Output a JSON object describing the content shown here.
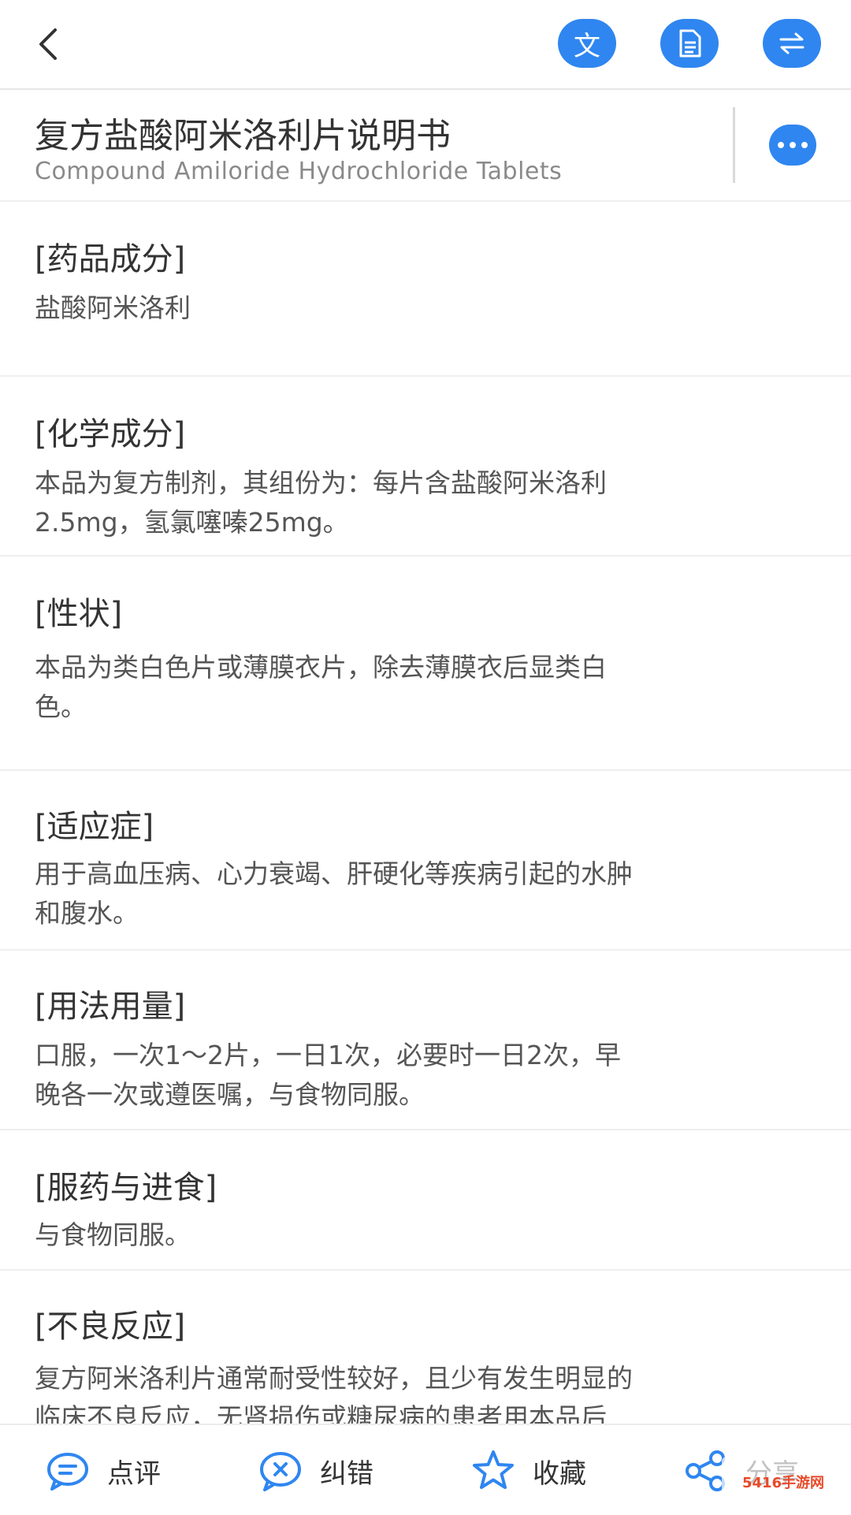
{
  "header": {
    "lang_icon_glyph": "文",
    "icons": [
      "back-arrow-icon",
      "translate-icon",
      "document-icon",
      "swap-icon"
    ],
    "accent_color": "#2f86f0"
  },
  "title": {
    "cn": "复方盐酸阿米洛利片说明书",
    "en": "Compound Amiloride Hydrochloride Tablets",
    "more_icon": "more-dots-icon"
  },
  "sections": [
    {
      "heading": "[药品成分]",
      "lines": [
        "盐酸阿米洛利"
      ]
    },
    {
      "heading": "[化学成分]",
      "lines": [
        "本品为复方制剂，其组份为：每片含盐酸阿米洛利",
        "2.5mg，氢氯噻嗪25mg。"
      ]
    },
    {
      "heading": "[性状]",
      "lines": [
        "本品为类白色片或薄膜衣片，除去薄膜衣后显类白",
        "色。"
      ]
    },
    {
      "heading": "[适应症]",
      "lines": [
        "用于高血压病、心力衰竭、肝硬化等疾病引起的水肿",
        "和腹水。"
      ]
    },
    {
      "heading": "[用法用量]",
      "lines": [
        "口服，一次1～2片，一日1次，必要时一日2次，早",
        "晚各一次或遵医嘱，与食物同服。"
      ]
    },
    {
      "heading": "[服药与进食]",
      "lines": [
        "与食物同服。"
      ]
    },
    {
      "heading": "[不良反应]",
      "lines": [
        "复方阿米洛利片通常耐受性较好，且少有发生明显的",
        "临床不良反应，无肾损伤或糖尿病的患者用本品后"
      ]
    }
  ],
  "bottom": {
    "items": [
      {
        "label": "点评",
        "icon": "comment-icon"
      },
      {
        "label": "纠错",
        "icon": "error-correct-icon"
      },
      {
        "label": "收藏",
        "icon": "star-icon"
      },
      {
        "label": "分享",
        "icon": "share-icon"
      }
    ]
  },
  "watermark": "5416手游网"
}
